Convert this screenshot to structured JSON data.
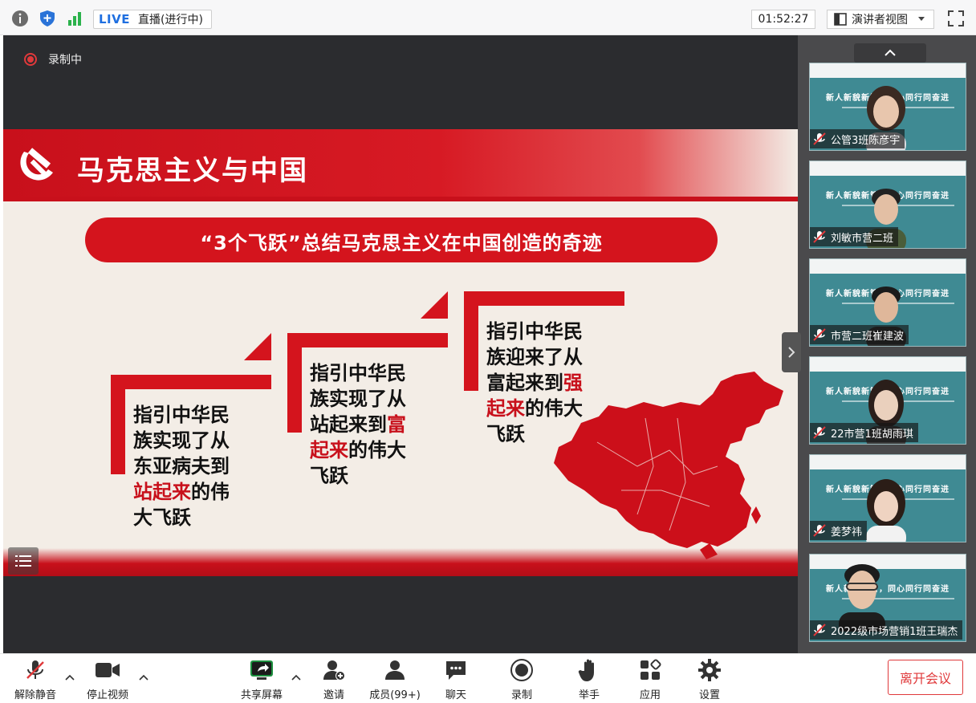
{
  "topbar": {
    "live_label": "LIVE",
    "live_status": "直播(进行中)",
    "timer": "01:52:27",
    "view_label": "演讲者视图"
  },
  "stage": {
    "recording_label": "录制中"
  },
  "slide": {
    "title": "马克思主义与中国",
    "banner": "“3个飞跃”总结马克思主义在中国创造的奇迹",
    "steps": [
      {
        "lines": [
          "指引中华民",
          "族实现了从",
          "东亚病夫到"
        ],
        "red": "站起来",
        "after_red": "的伟",
        "last": "大飞跃"
      },
      {
        "lines": [
          "指引中华民",
          "族实现了从",
          "站起来到"
        ],
        "red_inline": "富",
        "red": "起来",
        "after_red": "的伟大",
        "last": "飞跃"
      },
      {
        "lines": [
          "指引中华民",
          "族迎来了从",
          "富起来到"
        ],
        "red_inline": "强",
        "red": "起来",
        "after_red": "的伟大",
        "last": "飞跃"
      }
    ]
  },
  "participants": [
    {
      "name": "公管3班陈彦宇"
    },
    {
      "name": "刘敏市营二班"
    },
    {
      "name": "市营二班崔建波"
    },
    {
      "name": "22市营1班胡雨琪"
    },
    {
      "name": "姜梦祎"
    },
    {
      "name": "2022级市场营销1班王瑞杰"
    }
  ],
  "thumb_slide_title": "新人新貌新管，同心同行同奋进",
  "toolbar": {
    "unmute": "解除静音",
    "stop_video": "停止视频",
    "share": "共享屏幕",
    "invite": "邀请",
    "members": "成员(99+)",
    "chat": "聊天",
    "record": "录制",
    "raise_hand": "举手",
    "apps": "应用",
    "settings": "设置",
    "leave": "离开会议"
  },
  "colors": {
    "accent_red": "#c8101b",
    "live_blue": "#1f6fe0",
    "leave_red": "#e0393b"
  }
}
